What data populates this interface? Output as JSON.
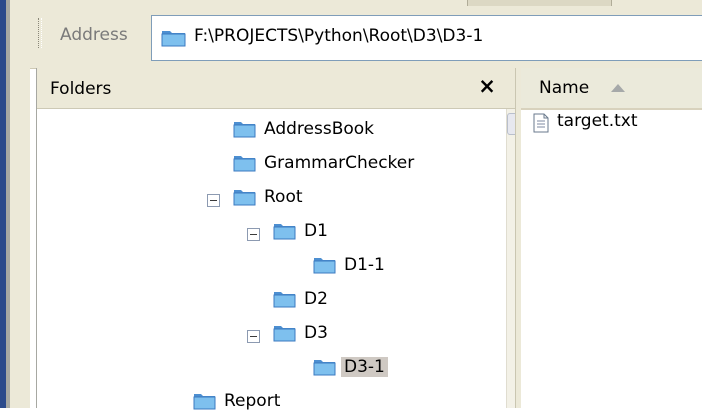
{
  "address": {
    "label": "Address",
    "path": "F:\\PROJECTS\\Python\\Root\\D3\\D3-1"
  },
  "folders_pane": {
    "title": "Folders",
    "close_glyph": "×",
    "tree": [
      {
        "label": "AddressBook",
        "level": 1,
        "expander": "none"
      },
      {
        "label": "GrammarChecker",
        "level": 1,
        "expander": "none"
      },
      {
        "label": "Root",
        "level": 1,
        "expander": "collapse"
      },
      {
        "label": "D1",
        "level": 2,
        "expander": "collapse"
      },
      {
        "label": "D1-1",
        "level": 3,
        "expander": "none"
      },
      {
        "label": "D2",
        "level": 2,
        "expander": "none"
      },
      {
        "label": "D3",
        "level": 2,
        "expander": "collapse"
      },
      {
        "label": "D3-1",
        "level": 3,
        "expander": "none",
        "selected": true
      },
      {
        "label": "Report",
        "level": 0,
        "expander": "none",
        "partially_visible": true
      }
    ]
  },
  "file_list": {
    "column_name": "Name",
    "sort": "ascending",
    "files": [
      {
        "name": "target.txt",
        "icon": "text-file-icon"
      }
    ]
  },
  "colors": {
    "folder_fill": "#6fb1e6",
    "folder_tab": "#4d8fd1",
    "selection": "#cfc9c3",
    "chrome": "#ece9d8"
  }
}
